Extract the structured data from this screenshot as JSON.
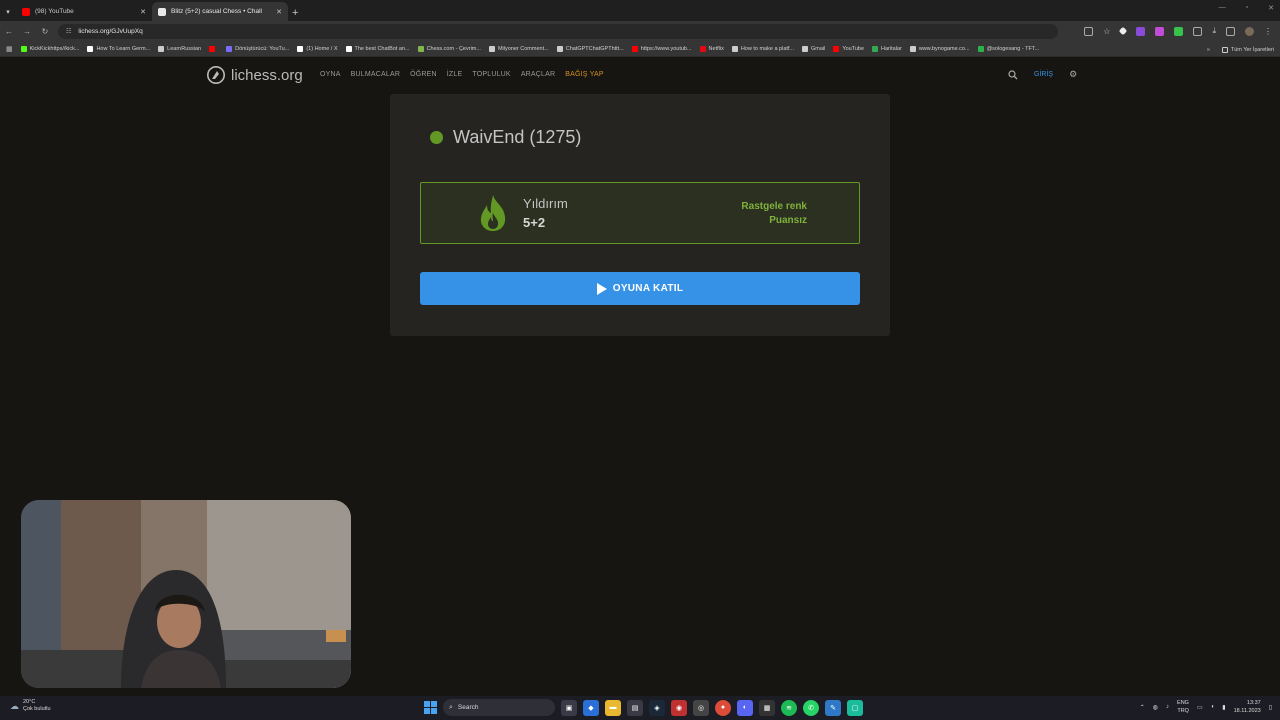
{
  "browser": {
    "tabs": [
      {
        "title": "(98) YouTube",
        "active": false,
        "favicon_color": "#ff0000"
      },
      {
        "title": "Blitz (5+2) casual Chess • Chall",
        "active": true,
        "favicon_color": "#e8e8e8"
      }
    ],
    "url": "lichess.org/GJvUupXq",
    "bookmarks": [
      {
        "label": "KickKickhttps//kick...",
        "color": "#53fc18"
      },
      {
        "label": "How To Learn Germ...",
        "color": "#ffffff"
      },
      {
        "label": "LearnRussian",
        "color": "#cccccc"
      },
      {
        "label": "",
        "color": "#ff0000"
      },
      {
        "label": "Dönüştürücü: YouTu...",
        "color": "#7a6cff"
      },
      {
        "label": "(1) Home / X",
        "color": "#ffffff"
      },
      {
        "label": "The best ChatBot an...",
        "color": "#ffffff"
      },
      {
        "label": "Chess.com - Çevrim...",
        "color": "#81b64c"
      },
      {
        "label": "Milyoner Comment...",
        "color": "#cccccc"
      },
      {
        "label": "ChatGPTChatGPThttt...",
        "color": "#cccccc"
      },
      {
        "label": "https://www.youtub...",
        "color": "#ff0000"
      },
      {
        "label": "Netflix",
        "color": "#e50914"
      },
      {
        "label": "How to make a platf...",
        "color": "#cccccc"
      },
      {
        "label": "Gmail",
        "color": "#cccccc"
      },
      {
        "label": "YouTube",
        "color": "#ff0000"
      },
      {
        "label": "Haritalar",
        "color": "#34a853"
      },
      {
        "label": "www.bynogame.co...",
        "color": "#cccccc"
      },
      {
        "label": "@sologesang - TFT...",
        "color": "#2bb24c"
      }
    ],
    "bookmarks_folder": "Tüm Yer İşaretleri"
  },
  "site": {
    "logo_text": "lichess.org",
    "nav": [
      "OYNA",
      "BULMACALAR",
      "ÖĞREN",
      "İZLE",
      "TOPLULUK",
      "ARAÇLAR"
    ],
    "donate": "BAĞIŞ YAP",
    "login": "GİRİŞ"
  },
  "challenge": {
    "opponent": "WaivEnd (1275)",
    "variant": "Yıldırım",
    "clock": "5+2",
    "color": "Rastgele renk",
    "rated": "Puansız",
    "join_label": "OYUNA KATIL"
  },
  "taskbar": {
    "weather_temp": "20°C",
    "weather_desc": "Çok bulutlu",
    "search_label": "Search",
    "lang_top": "ENG",
    "lang_bottom": "TRQ",
    "time": "13:37",
    "date": "18.11.2023"
  },
  "colors": {
    "accent_blue": "#3692e7",
    "online_green": "#629924",
    "donate_orange": "#d59020"
  }
}
